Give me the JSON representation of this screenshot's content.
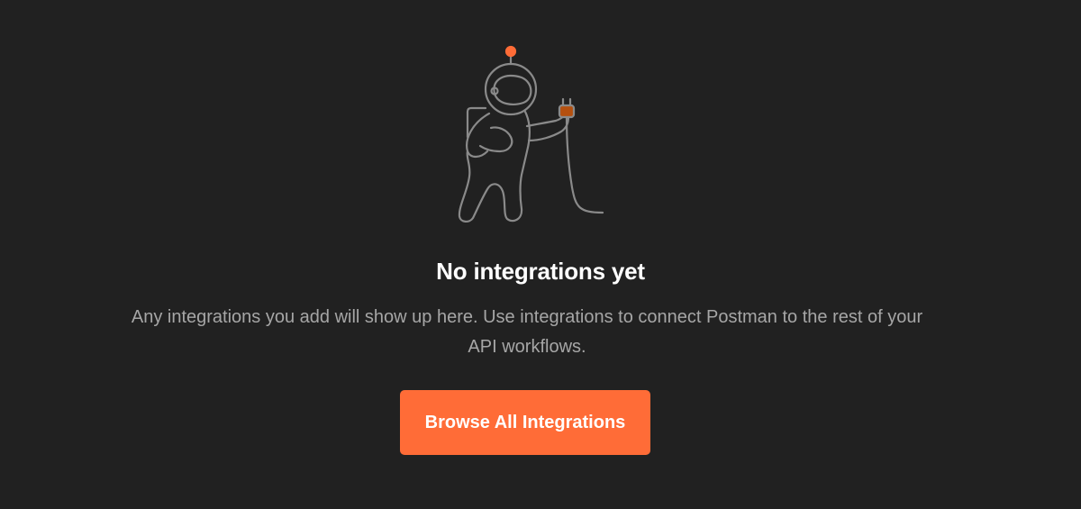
{
  "empty_state": {
    "illustration_icon": "astronaut-holding-plug-icon",
    "title": "No integrations yet",
    "description": "Any integrations you add will show up here. Use integrations to connect Postman to the rest of your API workflows.",
    "button_label": "Browse All Integrations"
  },
  "colors": {
    "background": "#212121",
    "accent": "#ff6c37",
    "title_text": "#ffffff",
    "body_text": "#a6a6a6",
    "illustration_stroke": "#8a8a8a"
  }
}
